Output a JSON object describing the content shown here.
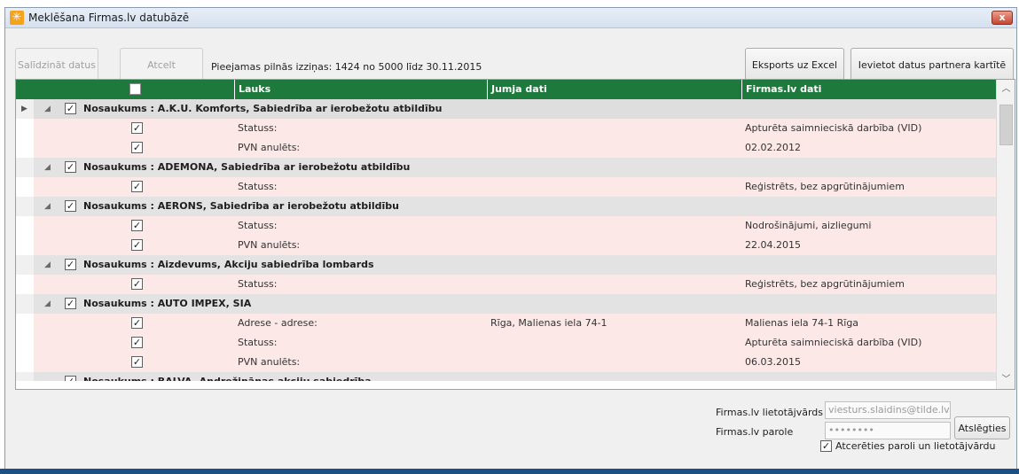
{
  "window": {
    "title": "Meklēšana Firmas.lv datubāzē",
    "close_label": "x"
  },
  "toolbar": {
    "compare_label": "Salīdzināt datus",
    "cancel_label": "Atcelt",
    "info": "Pieejamas pilnās izziņas: 1424 no 5000 līdz 30.11.2015",
    "export_label": "Eksports uz Excel",
    "insert_label": "Ievietot datus partnera kartītē"
  },
  "grid": {
    "columns": [
      "Lauks",
      "Jumja dati",
      "Firmas.lv dati"
    ],
    "groups": [
      {
        "label": "Nosaukums : A.K.U. Komforts, Sabiedrība ar ierobežotu atbildību",
        "rows": [
          {
            "field": "Statuss:",
            "jumja": "",
            "firmas": "Apturēta saimnieciskā darbība (VID)"
          },
          {
            "field": "PVN anulēts:",
            "jumja": "",
            "firmas": "02.02.2012"
          }
        ]
      },
      {
        "label": "Nosaukums : ADEMONA, Sabiedrība ar ierobežotu atbildību",
        "rows": [
          {
            "field": "Statuss:",
            "jumja": "",
            "firmas": "Reģistrēts, bez apgrūtinājumiem"
          }
        ]
      },
      {
        "label": "Nosaukums : AERONS, Sabiedrība ar ierobežotu atbildību",
        "rows": [
          {
            "field": "Statuss:",
            "jumja": "",
            "firmas": "Nodrošinājumi, aizliegumi"
          },
          {
            "field": "PVN anulēts:",
            "jumja": "",
            "firmas": "22.04.2015"
          }
        ]
      },
      {
        "label": "Nosaukums : Aizdevums, Akciju sabiedrība lombards",
        "rows": [
          {
            "field": "Statuss:",
            "jumja": "",
            "firmas": "Reģistrēts, bez apgrūtinājumiem"
          }
        ]
      },
      {
        "label": "Nosaukums : AUTO IMPEX, SIA",
        "rows": [
          {
            "field": "Adrese - adrese:",
            "jumja": "Rīga, Malienas iela 74-1",
            "firmas": "Malienas iela 74-1 Rīga"
          },
          {
            "field": "Statuss:",
            "jumja": "",
            "firmas": "Apturēta saimnieciskā darbība (VID)"
          },
          {
            "field": "PVN anulēts:",
            "jumja": "",
            "firmas": "06.03.2015"
          }
        ]
      }
    ],
    "partial_group_label": "Nosaukums : BALVA, Andrežināņas akciju sabiedrība"
  },
  "login": {
    "user_label": "Firmas.lv lietotājvārds",
    "user_value": "viesturs.slaidins@tilde.lv",
    "pass_label": "Firmas.lv parole",
    "pass_value": "••••••••",
    "keys_label": "Atslēgties",
    "remember_label": "Atcerēties paroli un lietotājvārdu"
  },
  "colors": {
    "header_green": "#1e7a3c",
    "detail_pink": "#fde8e8",
    "group_gray": "#e3e3e3"
  }
}
